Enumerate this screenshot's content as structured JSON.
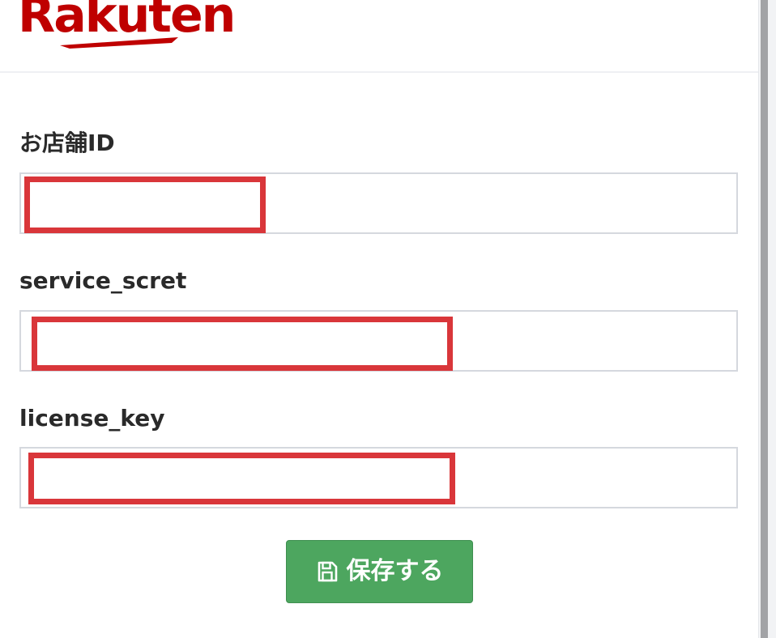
{
  "brand": {
    "logo_text": "Rakuten",
    "brand_color": "#bf0000"
  },
  "form": {
    "fields": [
      {
        "label": "お店舗ID",
        "value": ""
      },
      {
        "label": "service_scret",
        "value": ""
      },
      {
        "label": "license_key",
        "value": ""
      }
    ],
    "redaction_color": "#d9363a"
  },
  "actions": {
    "save_label": "保存する",
    "save_icon": "floppy-disk-icon",
    "save_color": "#4da65f"
  }
}
